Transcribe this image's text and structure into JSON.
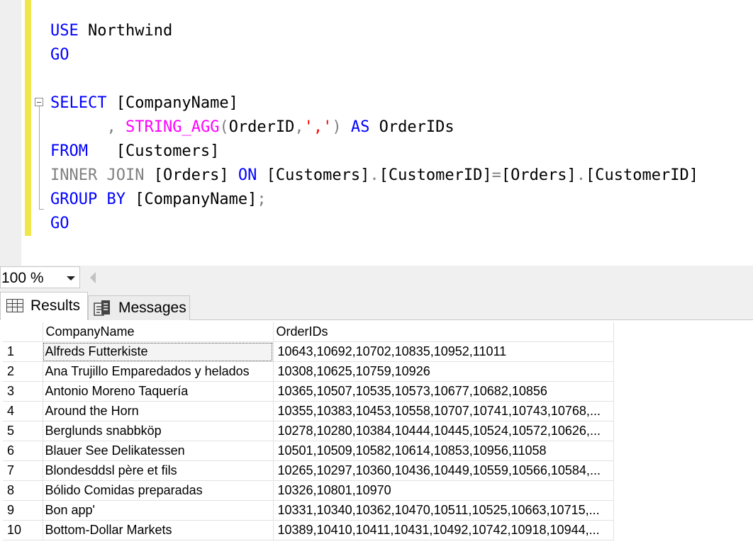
{
  "editor": {
    "lines": [
      [
        {
          "t": "USE ",
          "c": "kw"
        },
        {
          "t": "Northwind",
          "c": ""
        }
      ],
      [
        {
          "t": "GO",
          "c": "kw"
        }
      ],
      [],
      [
        {
          "t": "SELECT ",
          "c": "kw"
        },
        {
          "t": "[CompanyName]",
          "c": ""
        }
      ],
      [
        {
          "t": "      ",
          "c": ""
        },
        {
          "t": ", ",
          "c": "gr"
        },
        {
          "t": "STRING_AGG",
          "c": "fn"
        },
        {
          "t": "(",
          "c": "gr"
        },
        {
          "t": "OrderID",
          "c": ""
        },
        {
          "t": ",",
          "c": "gr"
        },
        {
          "t": "','",
          "c": "str"
        },
        {
          "t": ") ",
          "c": "gr"
        },
        {
          "t": "AS ",
          "c": "kw"
        },
        {
          "t": "OrderIDs",
          "c": ""
        }
      ],
      [
        {
          "t": "FROM",
          "c": "kw"
        },
        {
          "t": "   [Customers]",
          "c": ""
        }
      ],
      [
        {
          "t": "INNER JOIN ",
          "c": "gr"
        },
        {
          "t": "[Orders] ",
          "c": ""
        },
        {
          "t": "ON ",
          "c": "kw"
        },
        {
          "t": "[Customers]",
          "c": ""
        },
        {
          "t": ".",
          "c": "gr"
        },
        {
          "t": "[CustomerID]",
          "c": ""
        },
        {
          "t": "=",
          "c": "gr"
        },
        {
          "t": "[Orders]",
          "c": ""
        },
        {
          "t": ".",
          "c": "gr"
        },
        {
          "t": "[CustomerID]",
          "c": ""
        }
      ],
      [
        {
          "t": "GROUP BY ",
          "c": "kw"
        },
        {
          "t": "[CompanyName]",
          "c": ""
        },
        {
          "t": ";",
          "c": "gr"
        }
      ],
      [
        {
          "t": "GO",
          "c": "kw"
        }
      ]
    ]
  },
  "zoom": {
    "value": "100 %"
  },
  "tabs": {
    "results": "Results",
    "messages": "Messages"
  },
  "grid": {
    "columns": [
      "CompanyName",
      "OrderIDs"
    ],
    "rows": [
      [
        "1",
        "Alfreds Futterkiste",
        "10643,10692,10702,10835,10952,11011"
      ],
      [
        "2",
        "Ana Trujillo Emparedados y helados",
        "10308,10625,10759,10926"
      ],
      [
        "3",
        "Antonio Moreno Taquería",
        "10365,10507,10535,10573,10677,10682,10856"
      ],
      [
        "4",
        "Around the Horn",
        "10355,10383,10453,10558,10707,10741,10743,10768,..."
      ],
      [
        "5",
        "Berglunds snabbköp",
        "10278,10280,10384,10444,10445,10524,10572,10626,..."
      ],
      [
        "6",
        "Blauer See Delikatessen",
        "10501,10509,10582,10614,10853,10956,11058"
      ],
      [
        "7",
        "Blondesddsl père et fils",
        "10265,10297,10360,10436,10449,10559,10566,10584,..."
      ],
      [
        "8",
        "Bólido Comidas preparadas",
        "10326,10801,10970"
      ],
      [
        "9",
        "Bon app'",
        "10331,10340,10362,10470,10511,10525,10663,10715,..."
      ],
      [
        "10",
        "Bottom-Dollar Markets",
        "10389,10410,10411,10431,10492,10742,10918,10944,..."
      ]
    ]
  }
}
